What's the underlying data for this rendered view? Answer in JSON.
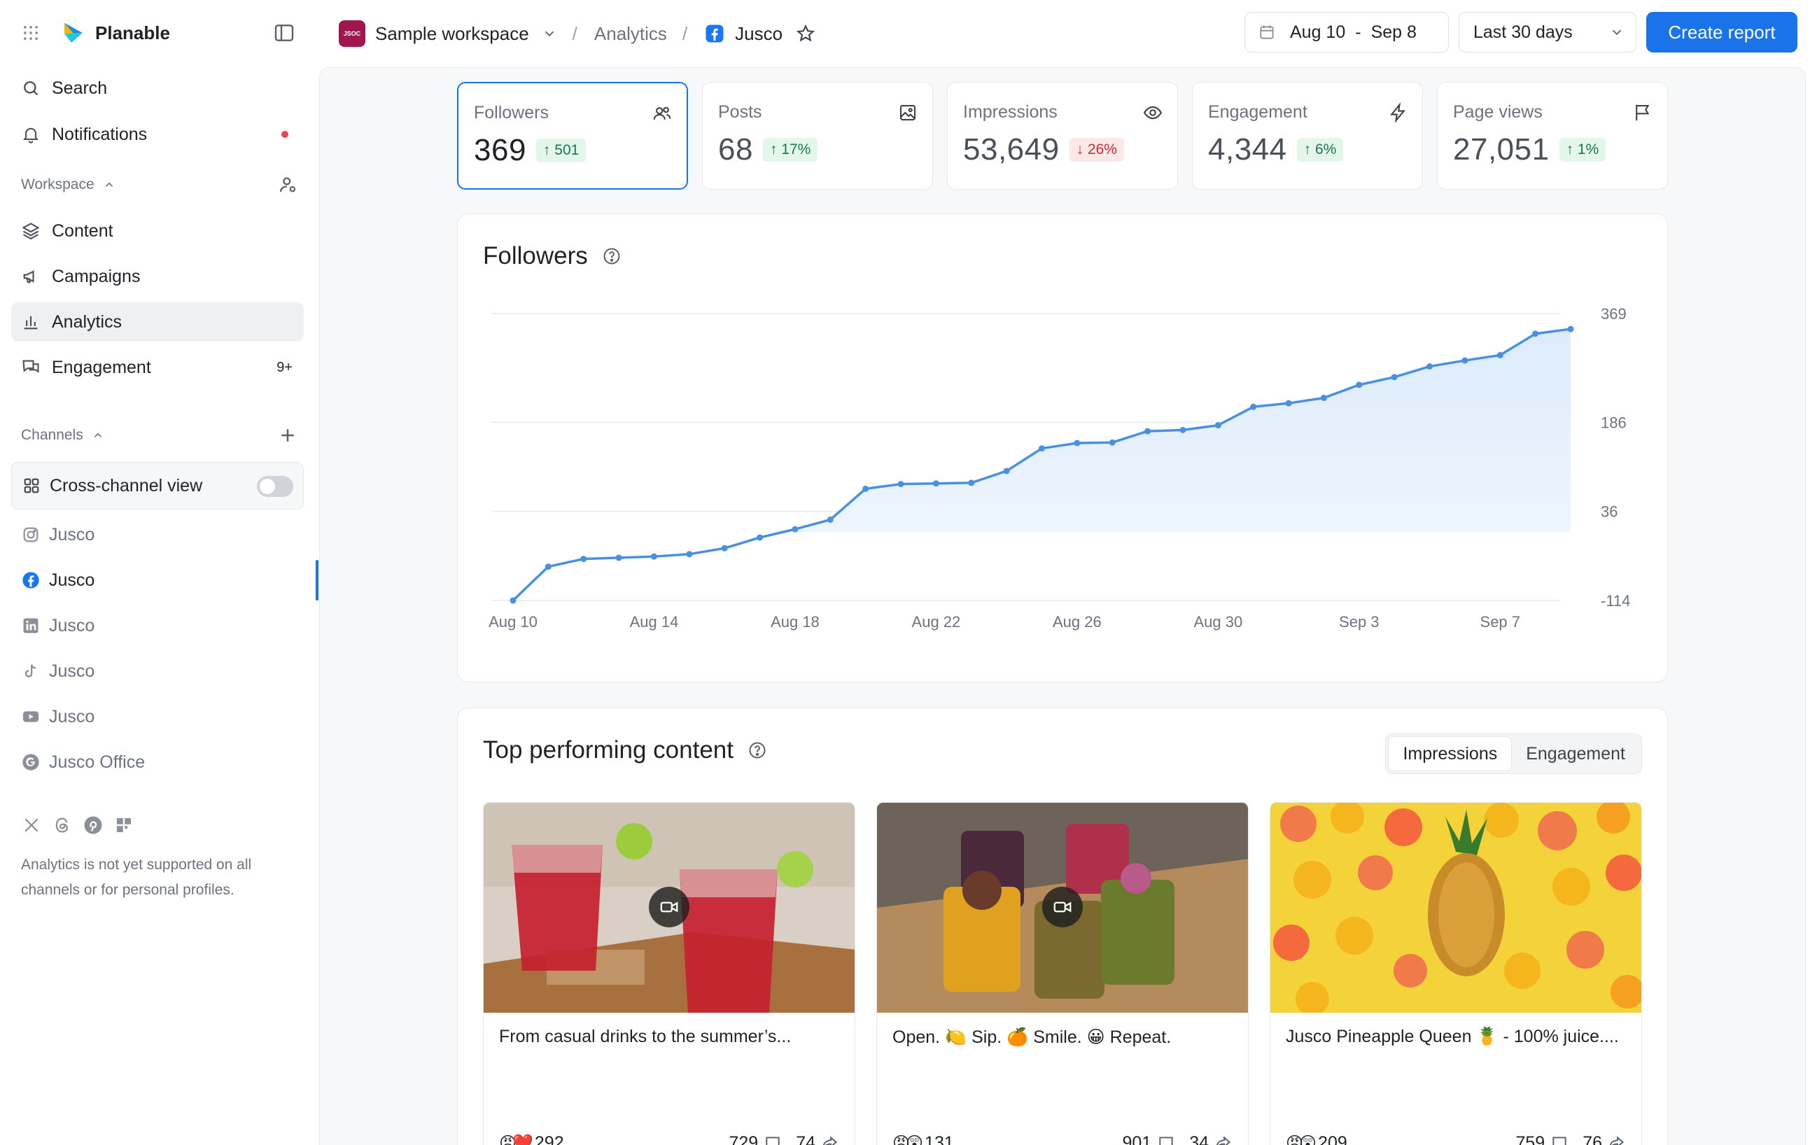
{
  "app": {
    "name": "Planable"
  },
  "sidebar": {
    "search": "Search",
    "notifications": "Notifications",
    "workspace_heading": "Workspace",
    "items": [
      {
        "label": "Content",
        "icon": "layers-icon"
      },
      {
        "label": "Campaigns",
        "icon": "megaphone-icon"
      },
      {
        "label": "Analytics",
        "icon": "bar-chart-icon",
        "active": true
      },
      {
        "label": "Engagement",
        "icon": "chat-icon",
        "badge": "9+"
      }
    ],
    "channels_heading": "Channels",
    "cross_channel": {
      "label": "Cross-channel view",
      "enabled": false
    },
    "channels": [
      {
        "label": "Jusco",
        "network": "instagram"
      },
      {
        "label": "Jusco",
        "network": "facebook",
        "active": true
      },
      {
        "label": "Jusco",
        "network": "linkedin"
      },
      {
        "label": "Jusco",
        "network": "tiktok"
      },
      {
        "label": "Jusco",
        "network": "youtube"
      },
      {
        "label": "Jusco Office",
        "network": "google-business"
      }
    ],
    "unsupported_note": "Analytics is not yet supported on all channels or for personal profiles."
  },
  "topbar": {
    "workspace_logo_text": "JSOC",
    "workspace": "Sample workspace",
    "crumb_analytics": "Analytics",
    "crumb_page": "Jusco",
    "date_start": "Aug 10",
    "date_sep": "-",
    "date_end": "Sep 8",
    "range": "Last 30 days",
    "create_report": "Create report",
    "accent": "#1a73e8"
  },
  "kpis": [
    {
      "label": "Followers",
      "value": "369",
      "delta": "501",
      "direction": "up",
      "icon": "users-icon",
      "selected": true
    },
    {
      "label": "Posts",
      "value": "68",
      "delta": "17%",
      "direction": "up",
      "icon": "image-icon"
    },
    {
      "label": "Impressions",
      "value": "53,649",
      "delta": "26%",
      "direction": "down",
      "icon": "eye-icon"
    },
    {
      "label": "Engagement",
      "value": "4,344",
      "delta": "6%",
      "direction": "up",
      "icon": "bolt-icon"
    },
    {
      "label": "Page views",
      "value": "27,051",
      "delta": "1%",
      "direction": "up",
      "icon": "flag-icon"
    }
  ],
  "followers_chart": {
    "title": "Followers",
    "chart_data": {
      "type": "area",
      "x_ticks": [
        "Aug 10",
        "Aug 14",
        "Aug 18",
        "Aug 22",
        "Aug 26",
        "Aug 30",
        "Sep 3",
        "Sep 7"
      ],
      "y_ticks": [
        369,
        186,
        36,
        -114
      ],
      "ylim": [
        -114,
        369
      ],
      "color": "#4a90e2",
      "series": [
        {
          "values": [
            -114,
            -57,
            -44,
            -42,
            -40,
            -36,
            -26,
            -8,
            6,
            22,
            74,
            82,
            83,
            84,
            104,
            142,
            151,
            152,
            171,
            173,
            181,
            212,
            218,
            227,
            249,
            262,
            280,
            290,
            299,
            335,
            343
          ]
        }
      ]
    }
  },
  "top_content": {
    "title": "Top performing content",
    "tabs": [
      {
        "label": "Impressions",
        "active": true
      },
      {
        "label": "Engagement",
        "active": false
      }
    ],
    "posts": [
      {
        "caption": "From casual drinks to the summer’s...",
        "reactions": "😡❤️",
        "reaction_count": "292",
        "comments": "729",
        "shares": "74",
        "video": true,
        "image": "red-drinks"
      },
      {
        "caption": "Open. 🍋 Sip. 🍊 Smile. 😀 Repeat.",
        "reactions": "😡😲",
        "reaction_count": "131",
        "comments": "901",
        "shares": "34",
        "video": true,
        "image": "smoothies"
      },
      {
        "caption": "Jusco Pineapple Queen 🍍 - 100% juice....",
        "reactions": "😡😲",
        "reaction_count": "209",
        "comments": "759",
        "shares": "76",
        "video": false,
        "image": "citrus-pineapple"
      }
    ]
  }
}
